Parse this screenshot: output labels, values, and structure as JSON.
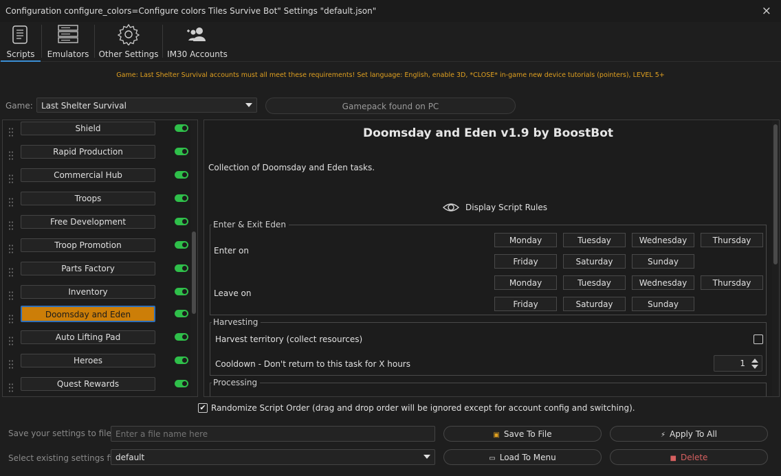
{
  "window": {
    "title": "Configuration configure_colors=Configure colors Tiles Survive Bot\" Settings \"default.json\"",
    "close_icon": "×"
  },
  "tabs": [
    {
      "label": "Scripts",
      "icon": "scroll-icon",
      "active": true
    },
    {
      "label": "Emulators",
      "icon": "server-stack-icon",
      "active": false
    },
    {
      "label": "Other Settings",
      "icon": "gear-icon",
      "active": false
    },
    {
      "label": "IM30 Accounts",
      "icon": "users-icon",
      "active": false
    }
  ],
  "notice": "Game: Last Shelter Survival accounts must all meet these requirements! Set language: English, enable 3D, *CLOSE* in-game new device tutorials (pointers), LEVEL 5+",
  "game": {
    "label": "Game:",
    "selected": "Last Shelter Survival",
    "gamepack_status": "Gamepack found on PC"
  },
  "scripts": [
    {
      "label": "Shield",
      "enabled": true,
      "selected": false
    },
    {
      "label": "Rapid Production",
      "enabled": true,
      "selected": false
    },
    {
      "label": "Commercial Hub",
      "enabled": true,
      "selected": false
    },
    {
      "label": "Troops",
      "enabled": true,
      "selected": false
    },
    {
      "label": "Free Development",
      "enabled": true,
      "selected": false
    },
    {
      "label": "Troop Promotion",
      "enabled": true,
      "selected": false
    },
    {
      "label": "Parts Factory",
      "enabled": true,
      "selected": false
    },
    {
      "label": "Inventory",
      "enabled": true,
      "selected": false
    },
    {
      "label": "Doomsday and Eden",
      "enabled": true,
      "selected": true
    },
    {
      "label": "Auto Lifting Pad",
      "enabled": true,
      "selected": false
    },
    {
      "label": "Heroes",
      "enabled": true,
      "selected": false
    },
    {
      "label": "Quest Rewards",
      "enabled": true,
      "selected": false
    }
  ],
  "detail": {
    "title": "Doomsday and Eden v1.9 by BoostBot",
    "description": "Collection of Doomsday and Eden tasks.",
    "rules_label": "Display Script Rules",
    "enter_exit": {
      "title": "Enter & Exit Eden",
      "enter_label": "Enter on",
      "leave_label": "Leave on",
      "days": [
        "Monday",
        "Tuesday",
        "Wednesday",
        "Thursday",
        "Friday",
        "Saturday",
        "Sunday"
      ]
    },
    "harvesting": {
      "title": "Harvesting",
      "harvest_label": "Harvest territory (collect resources)",
      "harvest_checked": false,
      "cooldown_label": "Cooldown - Don't return to this task for X hours",
      "cooldown_value": "1"
    },
    "processing": {
      "title": "Processing"
    }
  },
  "randomize": {
    "label": "Randomize Script Order (drag and drop order will be ignored except for account config and switching).",
    "checked": true,
    "check_glyph": "✔"
  },
  "bottom": {
    "save_label": "Save your settings to file",
    "file_placeholder": "Enter a file name here",
    "select_label": "Select existing settings file",
    "selected_file": "default",
    "save_button": "Save To File",
    "apply_button": "Apply To All",
    "load_button": "Load To Menu",
    "delete_button": "Delete",
    "accent_delete": "#d66060",
    "icons": {
      "save": "▣",
      "apply": "⚡",
      "load": "▭",
      "delete": "■"
    }
  },
  "colors": {
    "selected_script": "#cc7e08",
    "toggle_on": "#2fbf4a",
    "notice": "#e0a020",
    "active_tab": "#3b8fd6"
  }
}
